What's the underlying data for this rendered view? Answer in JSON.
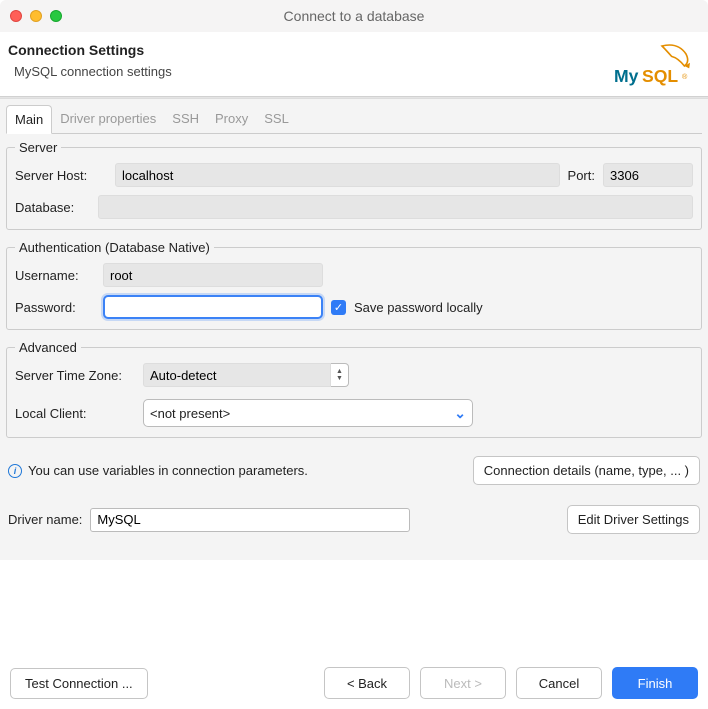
{
  "window": {
    "title": "Connect to a database"
  },
  "heading": {
    "title": "Connection Settings",
    "subtitle": "MySQL connection settings",
    "logo_text": "MySQL"
  },
  "tabs": [
    {
      "label": "Main",
      "active": true
    },
    {
      "label": "Driver properties",
      "active": false
    },
    {
      "label": "SSH",
      "active": false
    },
    {
      "label": "Proxy",
      "active": false
    },
    {
      "label": "SSL",
      "active": false
    }
  ],
  "groups": {
    "server": {
      "legend": "Server",
      "host_label": "Server Host:",
      "host_value": "localhost",
      "port_label": "Port:",
      "port_value": "3306",
      "database_label": "Database:",
      "database_value": ""
    },
    "auth": {
      "legend": "Authentication (Database Native)",
      "username_label": "Username:",
      "username_value": "root",
      "password_label": "Password:",
      "password_value": "",
      "save_checkbox_label": "Save password locally",
      "save_checked": true
    },
    "advanced": {
      "legend": "Advanced",
      "timezone_label": "Server Time Zone:",
      "timezone_value": "Auto-detect",
      "localclient_label": "Local Client:",
      "localclient_value": "<not present>"
    }
  },
  "info": {
    "variables_hint": "You can use variables in connection parameters.",
    "connection_details_btn": "Connection details (name, type, ... )"
  },
  "driver": {
    "name_label": "Driver name:",
    "name_value": "MySQL",
    "edit_btn": "Edit Driver Settings"
  },
  "buttons": {
    "test": "Test Connection ...",
    "back": "< Back",
    "next": "Next >",
    "cancel": "Cancel",
    "finish": "Finish"
  }
}
